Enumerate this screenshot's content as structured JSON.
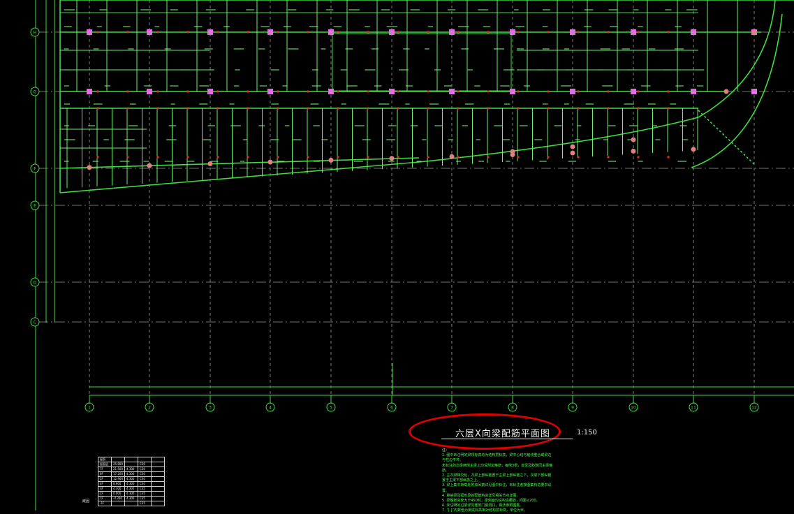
{
  "drawing": {
    "title": "六层X向梁配筋平面图",
    "scale": "1:150",
    "notes_header": "注：",
    "notes": [
      "1. 图中未注明的梁顶标高均为结构层标高，梁中心线与轴线重合或梁边与柱边平齐。",
      "   未标注的次梁两侧主梁上均设附加箍筋，每侧3根，直径及肢数同主梁箍筋。",
      "2. 主次梁相交处，次梁上部纵筋置于主梁上部纵筋之下，次梁下部纵筋置于主梁下部纵筋之上。",
      "3. 梁上集中荷载处附加吊筋详见图中标注，未标注者按图集构造要求设置。",
      "4. 悬挑梁及弧形梁的配筋构造详见相关节点详图。",
      "5. 梁腹板高度大于450时，梁侧面均设构造腰筋，间距≤200。",
      "6. 未注明的过梁详见建筑门窗洞口，做法参照图集。",
      "7. “[ ]”内数值为梁底标高相对结构层标高，单位为米。"
    ],
    "axes_vertical": [
      "1",
      "2",
      "3",
      "4",
      "5",
      "6",
      "7",
      "8",
      "9",
      "10",
      "11",
      "12"
    ],
    "axes_horizontal": [
      "H",
      "G",
      "F",
      "E",
      "D",
      "C"
    ],
    "legend_rows": [
      [
        "屋面",
        "",
        "",
        "",
        ""
      ],
      [
        "屋面层",
        "25.800",
        "",
        "C30",
        ""
      ],
      [
        "7F",
        "21.500",
        "4.300",
        "C30",
        ""
      ],
      [
        "6F",
        "17.200",
        "4.300",
        "C30",
        ""
      ],
      [
        "5F",
        "12.900",
        "4.300",
        "C30",
        ""
      ],
      [
        "4F",
        "8.600",
        "4.300",
        "C30",
        ""
      ],
      [
        "3F",
        "4.300",
        "4.300",
        "C35",
        ""
      ],
      [
        "2F",
        "0.000",
        "4.300",
        "C35",
        ""
      ],
      [
        "1F",
        "-4.300",
        "4.300",
        "C35",
        ""
      ],
      [
        "-1F",
        "",
        "",
        "C35",
        ""
      ]
    ],
    "legend_side_label": "嵌固",
    "colors": {
      "background": "#000000",
      "line_green": "#3ddc3d",
      "beam_green": "#7dff7d",
      "text_green": "#4cff4c",
      "column_magenta": "#e070e0",
      "column_red": "#e03030",
      "axis_gray": "#9a9a9a",
      "highlight_red": "#e00000"
    }
  }
}
